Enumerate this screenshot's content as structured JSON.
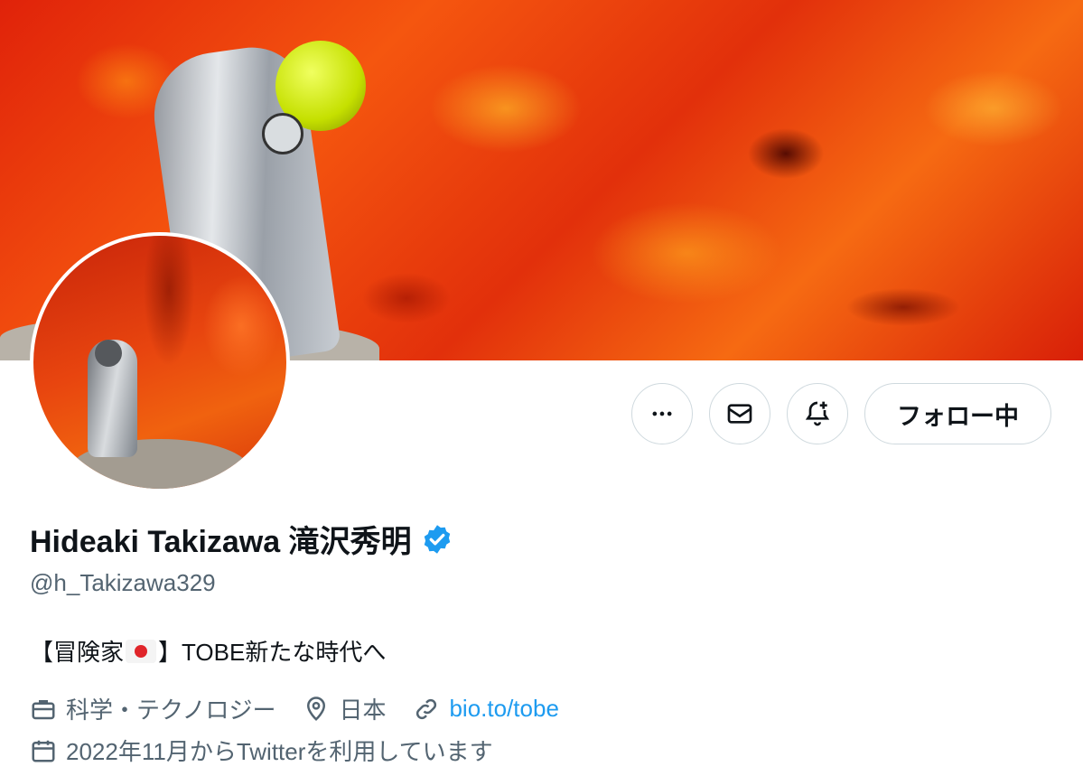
{
  "profile": {
    "name": "Hideaki Takizawa 滝沢秀明",
    "handle": "@h_Takizawa329",
    "bio_start": "【冒険家",
    "bio_end": "】TOBE新たな時代へ",
    "category": "科学・テクノロジー",
    "location": "日本",
    "link": "bio.to/tobe",
    "joined": "2022年11月からTwitterを利用しています"
  },
  "actions": {
    "follow_label": "フォロー中"
  },
  "icons": {
    "more": "more-icon",
    "message": "envelope-icon",
    "notify": "bell-plus-icon",
    "verified": "verified-badge-icon",
    "category": "briefcase-icon",
    "location": "location-pin-icon",
    "link": "link-icon",
    "joined": "calendar-icon"
  },
  "colors": {
    "accent": "#1d9bf0",
    "text": "#0f1419",
    "secondary": "#536471",
    "border": "#cfd9de"
  }
}
